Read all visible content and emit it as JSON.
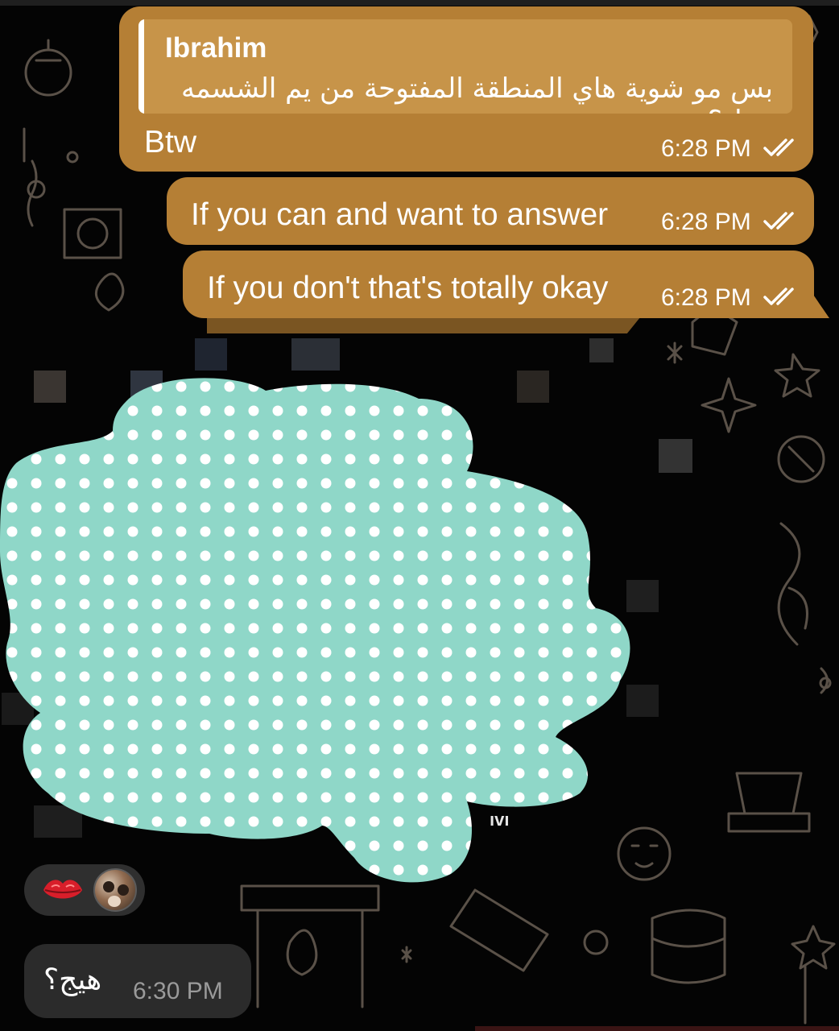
{
  "chat": {
    "messages": [
      {
        "direction": "outgoing",
        "reply": {
          "author": "Ibrahim",
          "text": "بس مو شوية هاي المنطقة المفتوحة من يم الشسمه تنزل؟"
        },
        "text": "Btw",
        "time": "6:28 PM",
        "status": "read"
      },
      {
        "direction": "outgoing",
        "text": "If you can and want to answer",
        "time": "6:28 PM",
        "status": "read"
      },
      {
        "direction": "outgoing",
        "text": "If you don't that's totally okay",
        "time": "6:28 PM",
        "status": "read"
      },
      {
        "direction": "incoming",
        "type": "media",
        "redacted": true,
        "time_fragment": "ıvı"
      },
      {
        "direction": "incoming",
        "text": "هيج؟",
        "time": "6:30 PM"
      }
    ],
    "reactions": {
      "emoji": "lips-kiss-icon",
      "reactor": "avatar"
    }
  },
  "colors": {
    "outgoing_bubble": "#b57f35",
    "reply_box": "#c79449",
    "incoming_bubble": "#2b2b2b",
    "redaction_fill": "#8fd7c8",
    "background": "#040404"
  }
}
